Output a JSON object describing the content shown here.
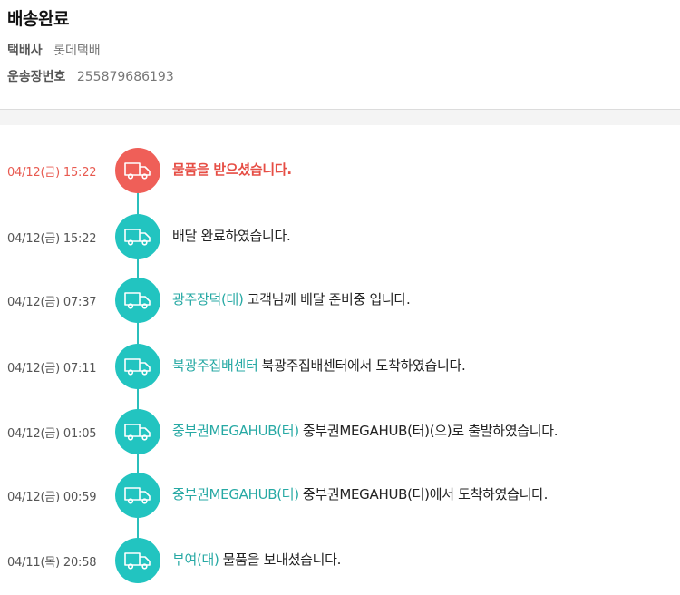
{
  "header": {
    "status_title": "배송완료",
    "carrier_label": "택배사",
    "carrier_value": "롯데택배",
    "tracking_label": "운송장번호",
    "tracking_value": "255879686193"
  },
  "icon": "delivery-truck-icon",
  "colors": {
    "active": "#ef5f58",
    "normal": "#22c4c0",
    "location_text": "#27a9a4"
  },
  "events": [
    {
      "time": "04/12(금) 15:22",
      "location": "",
      "description": "물품을 받으셨습니다."
    },
    {
      "time": "04/12(금) 15:22",
      "location": "",
      "description": "배달 완료하였습니다."
    },
    {
      "time": "04/12(금) 07:37",
      "location": "광주장덕(대)",
      "description": "고객님께 배달 준비중 입니다."
    },
    {
      "time": "04/12(금) 07:11",
      "location": "북광주집배센터",
      "description": "북광주집배센터에서 도착하였습니다."
    },
    {
      "time": "04/12(금) 01:05",
      "location": "중부권MEGAHUB(터)",
      "description": "중부권MEGAHUB(터)(으)로 출발하였습니다."
    },
    {
      "time": "04/12(금) 00:59",
      "location": "중부권MEGAHUB(터)",
      "description": "중부권MEGAHUB(터)에서 도착하였습니다."
    },
    {
      "time": "04/11(목) 20:58",
      "location": "부여(대)",
      "description": "물품을 보내셨습니다."
    }
  ]
}
